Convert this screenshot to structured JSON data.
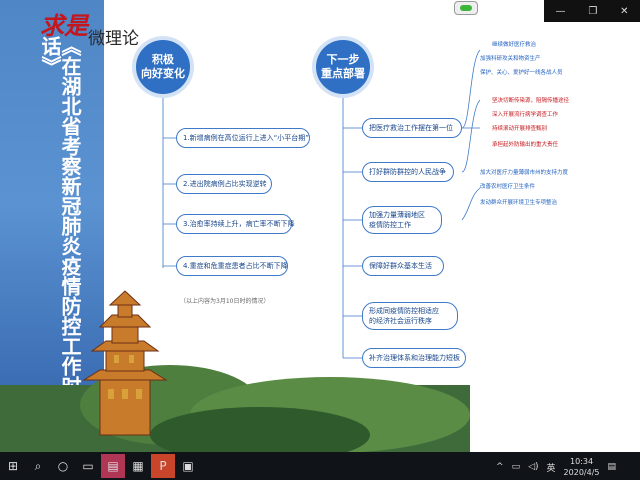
{
  "window": {
    "minimize": "—",
    "restore": "❐",
    "close": "✕"
  },
  "branding": {
    "logo_mark": "求是",
    "logo_text": "微理论"
  },
  "vertical_title": "《在湖北省考察新冠肺炎疫情防控工作时的讲话》",
  "left_circle": "积极\n向好变化",
  "right_circle": "下一步\n重点部署",
  "left_items": [
    "1.新增病例在高位运行上进入“小平台期”",
    "2.进出院病例占比实现逆转",
    "3.治愈率持续上升，病亡率不断下降",
    "4.重症和危重症患者占比不断下降"
  ],
  "left_note": "（以上内容为3月10日时的情况）",
  "right_items": [
    "把医疗救治工作摆在第一位",
    "打好群防群控的人民战争",
    "加强力量薄弱地区\n疫情防控工作",
    "保障好群众基本生活",
    "形成同疫情防控相适应\n的经济社会运行秩序",
    "补齐治理体系和治理能力短板"
  ],
  "sub_group_1": [
    "继续做好医疗救治",
    "加强科研攻关和物资生产",
    "保护、关心、爱护好一线各战人员"
  ],
  "sub_group_2": [
    "坚决切断传染源，阻隔传播途径",
    "深入开展流行病学调查工作",
    "持续滚动开展排查甄别",
    "承担起外防输出的重大责任"
  ],
  "sub_group_3": [
    "加大对医疗力量薄弱市州的支持力度",
    "改善农村医疗卫生条件",
    "发动群众开展环境卫生专项整治"
  ],
  "taskbar": {
    "start": "⊞",
    "search": "⌕",
    "cortana": "○",
    "task_view": "▭",
    "app1": "▤",
    "app2": "▦",
    "app3": "P",
    "app4": "▣"
  },
  "tray": {
    "up_arrow": "^",
    "network": "▭",
    "volume": "◁)",
    "ime": "英",
    "time": "10:34",
    "date": "2020/4/5",
    "notify": "▤"
  },
  "colors": {
    "band_blue": "#4f86c6",
    "accent": "#2f6fc4",
    "red": "#c4161c"
  }
}
